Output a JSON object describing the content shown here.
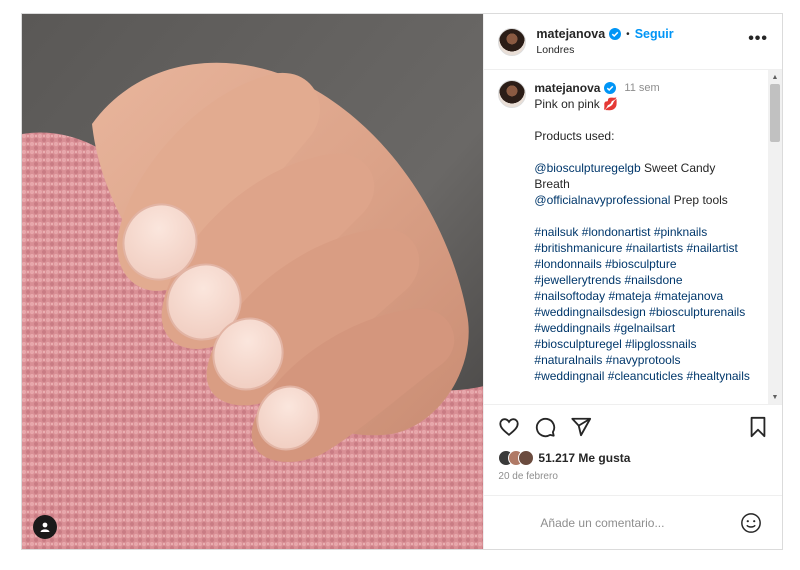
{
  "post": {
    "author": {
      "username": "matejanova",
      "follow_label": "Seguir",
      "location": "Londres",
      "dot": "•",
      "more_label": "•••"
    },
    "caption": {
      "username": "matejanova",
      "time_ago": "11 sem",
      "title": "Pink on pink 💋",
      "products_heading": "Products used:",
      "product_1_mention": "@biosculpturegelgb",
      "product_1_text": " Sweet Candy Breath",
      "product_2_mention": "@officialnavyprofessional",
      "product_2_text": " Prep tools",
      "hashtags": [
        "#nailsuk",
        "#londonartist",
        "#pinknails",
        "#britishmanicure",
        "#nailartists",
        "#nailartist",
        "#londonnails",
        "#biosculpture",
        "#jewellerytrends",
        "#nailsdone",
        "#nailsoftoday",
        "#mateja",
        "#matejanova",
        "#weddingnailsdesign",
        "#biosculpturenails",
        "#weddingnails",
        "#gelnailsart",
        "#biosculpturegel",
        "#lipglossnails",
        "#naturalnails",
        "#navyprotools",
        "#weddingnail",
        "#cleancuticles",
        "#healtynails"
      ]
    },
    "likes": {
      "count_label": "51.217 Me gusta"
    },
    "date": "20 de febrero",
    "comment_box": {
      "placeholder": "Añade un comentario..."
    },
    "scrollbar": {
      "up": "▲",
      "down": "▼"
    },
    "colors": {
      "accent": "#0095f6",
      "verified": "#0095f6",
      "link": "#00376b",
      "muted": "#8e8e8e"
    },
    "icons": [
      "verified-badge-icon",
      "more-options-icon",
      "heart-icon",
      "comment-icon",
      "share-icon",
      "bookmark-icon",
      "smiley-icon",
      "user-tag-icon"
    ]
  }
}
